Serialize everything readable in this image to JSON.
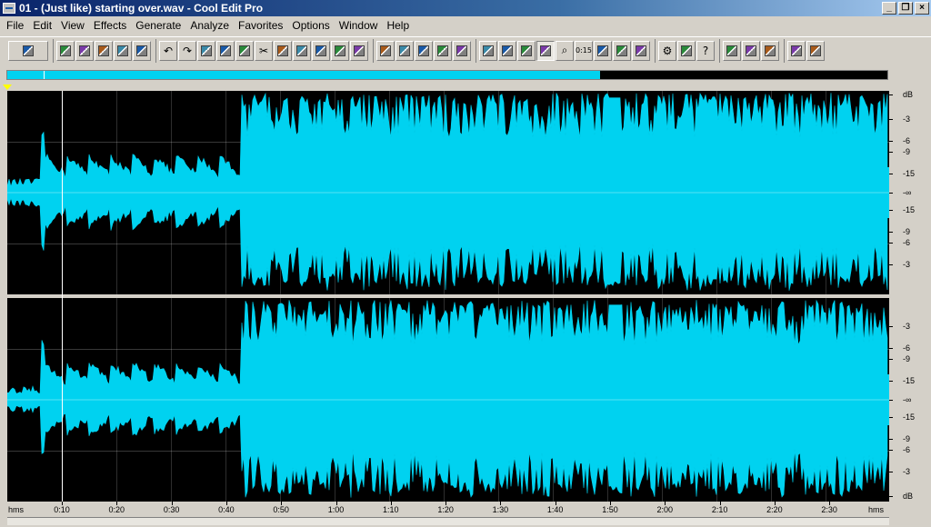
{
  "window": {
    "title": "01 - (Just like) starting over.wav - Cool Edit Pro",
    "controls": [
      "_",
      "❐",
      "×"
    ]
  },
  "menu": [
    "File",
    "Edit",
    "View",
    "Effects",
    "Generate",
    "Analyze",
    "Favorites",
    "Options",
    "Window",
    "Help"
  ],
  "toolbar": {
    "groups": [
      [
        "multitrack-toggle-icon"
      ],
      [
        "new-icon",
        "open-icon",
        "close-icon",
        "save-icon",
        "save-all-icon"
      ],
      [
        "undo-icon",
        "redo-icon",
        "repeat-icon",
        "copy-new-icon",
        "copy-icon",
        "cut-icon",
        "paste-icon",
        "paste-new-icon",
        "mix-paste-icon",
        "effects-icon",
        "find-icon"
      ],
      [
        "envelope-icon",
        "spectral-icon",
        "view-a-icon",
        "view-b-icon",
        "view-c-icon"
      ],
      [
        "window-icon",
        "info-icon",
        "cue-list-icon",
        "play-list-icon",
        "zoom-icon",
        "time-icon",
        "marker-icon",
        "meter-icon",
        "level-icon"
      ],
      [
        "settings-icon",
        "script-icon",
        "help-icon"
      ],
      [
        "track-view-icon",
        "zoom-sel-icon",
        "fit-icon"
      ],
      [
        "tools-icon",
        "undo-list-icon"
      ]
    ]
  },
  "overview": {
    "visible_fraction": 0.674
  },
  "db_scale": {
    "header": "dB",
    "footer": "dB",
    "channel_labels": [
      "-3",
      "-6",
      "-9",
      "-15",
      "-∞",
      "-15",
      "-9",
      "-6",
      "-3"
    ]
  },
  "time_ruler": {
    "left_unit": "hms",
    "right_unit": "hms",
    "ticks": [
      "0:10",
      "0:20",
      "0:30",
      "0:40",
      "0:50",
      "1:00",
      "1:10",
      "1:20",
      "1:30",
      "1:40",
      "1:50",
      "2:00",
      "2:10",
      "2:20",
      "2:30"
    ]
  },
  "colors": {
    "waveform": "#00d2f0",
    "background": "#000000",
    "cursor": "#ffffff"
  }
}
